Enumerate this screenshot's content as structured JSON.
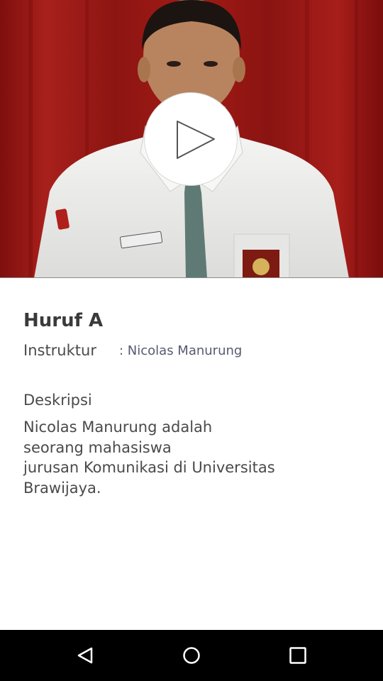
{
  "video": {
    "background_color": "#9a1412",
    "play_icon": "play-icon"
  },
  "lesson": {
    "title": "Huruf A",
    "instruktur_label": "Instruktur",
    "instruktur_value": ": Nicolas Manurung",
    "deskripsi_label": "Deskripsi",
    "deskripsi_text": "        Nicolas Manurung adalah\nseorang mahasiswa\njurusan Komunikasi di Universitas\nBrawijaya."
  },
  "navbar": {
    "back_icon": "back-triangle-icon",
    "home_icon": "home-circle-icon",
    "recent_icon": "recent-apps-square-icon"
  }
}
